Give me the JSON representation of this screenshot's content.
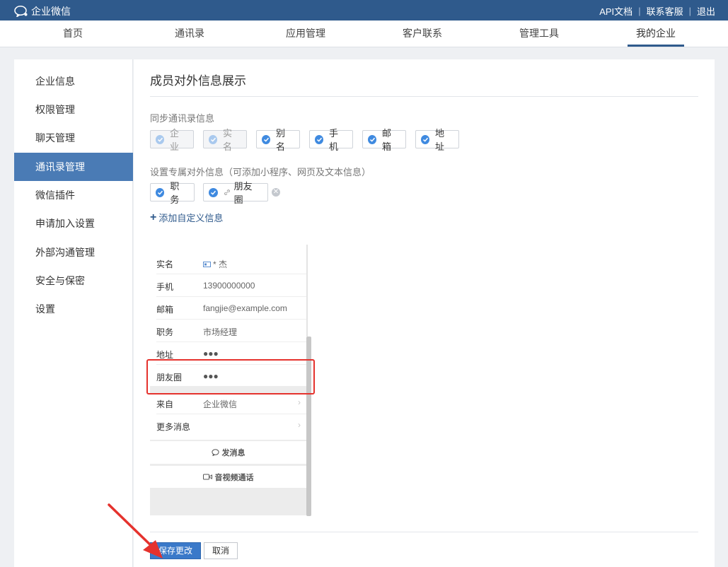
{
  "topbar": {
    "logo_text": "企业微信",
    "links": [
      "API文档",
      "联系客服",
      "退出"
    ],
    "separator": "|"
  },
  "nav": {
    "items": [
      "首页",
      "通讯录",
      "应用管理",
      "客户联系",
      "管理工具",
      "我的企业"
    ],
    "active": "我的企业"
  },
  "sidebar": {
    "items": [
      "企业信息",
      "权限管理",
      "聊天管理",
      "通讯录管理",
      "微信插件",
      "申请加入设置",
      "外部沟通管理",
      "安全与保密",
      "设置"
    ],
    "active": "通讯录管理"
  },
  "main": {
    "title": "成员对外信息展示",
    "sync_label": "同步通讯录信息",
    "sync_chips": [
      {
        "label": "企业",
        "disabled": true
      },
      {
        "label": "实名",
        "disabled": true
      },
      {
        "label": "别名",
        "disabled": false
      },
      {
        "label": "手机",
        "disabled": false
      },
      {
        "label": "邮箱",
        "disabled": false
      },
      {
        "label": "地址",
        "disabled": false
      }
    ],
    "custom_label": "设置专属对外信息（可添加小程序、网页及文本信息）",
    "custom_chips": [
      {
        "label": "职务"
      },
      {
        "label": "朋友圈",
        "link_icon": "🔗"
      }
    ],
    "add_custom": "添加自定义信息",
    "save": "保存更改",
    "cancel": "取消"
  },
  "preview": {
    "rows": [
      {
        "key": "实名",
        "value": "* 杰",
        "id_icon": true
      },
      {
        "key": "手机",
        "value": "13900000000"
      },
      {
        "key": "邮箱",
        "value": "fangjie@example.com"
      },
      {
        "key": "职务",
        "value": "市场经理"
      },
      {
        "key": "地址",
        "value": "●●●"
      },
      {
        "key": "朋友圈",
        "value": "●●●"
      }
    ],
    "source_rows": [
      {
        "key": "来自",
        "value": "企业微信",
        "arrow": "›"
      },
      {
        "key": "更多消息",
        "value": "",
        "arrow": "›"
      }
    ],
    "actions": [
      "发消息",
      "音视频通话"
    ]
  },
  "colors": {
    "brand": "#2f5a8c",
    "active_sidebar": "#4a7bb5",
    "check": "#3f8ae0",
    "highlight": "#e5322d",
    "primary_button": "#3a79c9"
  }
}
